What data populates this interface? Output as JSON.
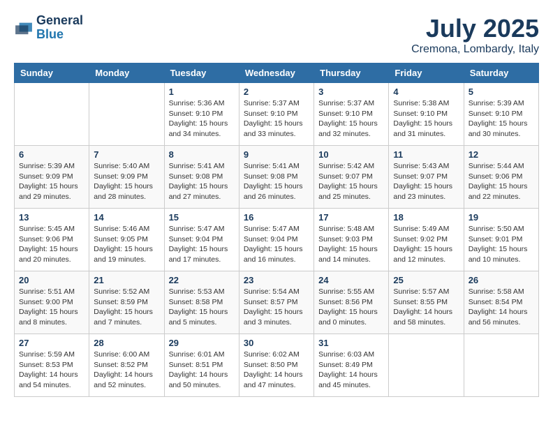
{
  "header": {
    "logo_line1": "General",
    "logo_line2": "Blue",
    "month": "July 2025",
    "location": "Cremona, Lombardy, Italy"
  },
  "weekdays": [
    "Sunday",
    "Monday",
    "Tuesday",
    "Wednesday",
    "Thursday",
    "Friday",
    "Saturday"
  ],
  "weeks": [
    [
      {
        "day": "",
        "info": ""
      },
      {
        "day": "",
        "info": ""
      },
      {
        "day": "1",
        "info": "Sunrise: 5:36 AM\nSunset: 9:10 PM\nDaylight: 15 hours\nand 34 minutes."
      },
      {
        "day": "2",
        "info": "Sunrise: 5:37 AM\nSunset: 9:10 PM\nDaylight: 15 hours\nand 33 minutes."
      },
      {
        "day": "3",
        "info": "Sunrise: 5:37 AM\nSunset: 9:10 PM\nDaylight: 15 hours\nand 32 minutes."
      },
      {
        "day": "4",
        "info": "Sunrise: 5:38 AM\nSunset: 9:10 PM\nDaylight: 15 hours\nand 31 minutes."
      },
      {
        "day": "5",
        "info": "Sunrise: 5:39 AM\nSunset: 9:10 PM\nDaylight: 15 hours\nand 30 minutes."
      }
    ],
    [
      {
        "day": "6",
        "info": "Sunrise: 5:39 AM\nSunset: 9:09 PM\nDaylight: 15 hours\nand 29 minutes."
      },
      {
        "day": "7",
        "info": "Sunrise: 5:40 AM\nSunset: 9:09 PM\nDaylight: 15 hours\nand 28 minutes."
      },
      {
        "day": "8",
        "info": "Sunrise: 5:41 AM\nSunset: 9:08 PM\nDaylight: 15 hours\nand 27 minutes."
      },
      {
        "day": "9",
        "info": "Sunrise: 5:41 AM\nSunset: 9:08 PM\nDaylight: 15 hours\nand 26 minutes."
      },
      {
        "day": "10",
        "info": "Sunrise: 5:42 AM\nSunset: 9:07 PM\nDaylight: 15 hours\nand 25 minutes."
      },
      {
        "day": "11",
        "info": "Sunrise: 5:43 AM\nSunset: 9:07 PM\nDaylight: 15 hours\nand 23 minutes."
      },
      {
        "day": "12",
        "info": "Sunrise: 5:44 AM\nSunset: 9:06 PM\nDaylight: 15 hours\nand 22 minutes."
      }
    ],
    [
      {
        "day": "13",
        "info": "Sunrise: 5:45 AM\nSunset: 9:06 PM\nDaylight: 15 hours\nand 20 minutes."
      },
      {
        "day": "14",
        "info": "Sunrise: 5:46 AM\nSunset: 9:05 PM\nDaylight: 15 hours\nand 19 minutes."
      },
      {
        "day": "15",
        "info": "Sunrise: 5:47 AM\nSunset: 9:04 PM\nDaylight: 15 hours\nand 17 minutes."
      },
      {
        "day": "16",
        "info": "Sunrise: 5:47 AM\nSunset: 9:04 PM\nDaylight: 15 hours\nand 16 minutes."
      },
      {
        "day": "17",
        "info": "Sunrise: 5:48 AM\nSunset: 9:03 PM\nDaylight: 15 hours\nand 14 minutes."
      },
      {
        "day": "18",
        "info": "Sunrise: 5:49 AM\nSunset: 9:02 PM\nDaylight: 15 hours\nand 12 minutes."
      },
      {
        "day": "19",
        "info": "Sunrise: 5:50 AM\nSunset: 9:01 PM\nDaylight: 15 hours\nand 10 minutes."
      }
    ],
    [
      {
        "day": "20",
        "info": "Sunrise: 5:51 AM\nSunset: 9:00 PM\nDaylight: 15 hours\nand 8 minutes."
      },
      {
        "day": "21",
        "info": "Sunrise: 5:52 AM\nSunset: 8:59 PM\nDaylight: 15 hours\nand 7 minutes."
      },
      {
        "day": "22",
        "info": "Sunrise: 5:53 AM\nSunset: 8:58 PM\nDaylight: 15 hours\nand 5 minutes."
      },
      {
        "day": "23",
        "info": "Sunrise: 5:54 AM\nSunset: 8:57 PM\nDaylight: 15 hours\nand 3 minutes."
      },
      {
        "day": "24",
        "info": "Sunrise: 5:55 AM\nSunset: 8:56 PM\nDaylight: 15 hours\nand 0 minutes."
      },
      {
        "day": "25",
        "info": "Sunrise: 5:57 AM\nSunset: 8:55 PM\nDaylight: 14 hours\nand 58 minutes."
      },
      {
        "day": "26",
        "info": "Sunrise: 5:58 AM\nSunset: 8:54 PM\nDaylight: 14 hours\nand 56 minutes."
      }
    ],
    [
      {
        "day": "27",
        "info": "Sunrise: 5:59 AM\nSunset: 8:53 PM\nDaylight: 14 hours\nand 54 minutes."
      },
      {
        "day": "28",
        "info": "Sunrise: 6:00 AM\nSunset: 8:52 PM\nDaylight: 14 hours\nand 52 minutes."
      },
      {
        "day": "29",
        "info": "Sunrise: 6:01 AM\nSunset: 8:51 PM\nDaylight: 14 hours\nand 50 minutes."
      },
      {
        "day": "30",
        "info": "Sunrise: 6:02 AM\nSunset: 8:50 PM\nDaylight: 14 hours\nand 47 minutes."
      },
      {
        "day": "31",
        "info": "Sunrise: 6:03 AM\nSunset: 8:49 PM\nDaylight: 14 hours\nand 45 minutes."
      },
      {
        "day": "",
        "info": ""
      },
      {
        "day": "",
        "info": ""
      }
    ]
  ]
}
